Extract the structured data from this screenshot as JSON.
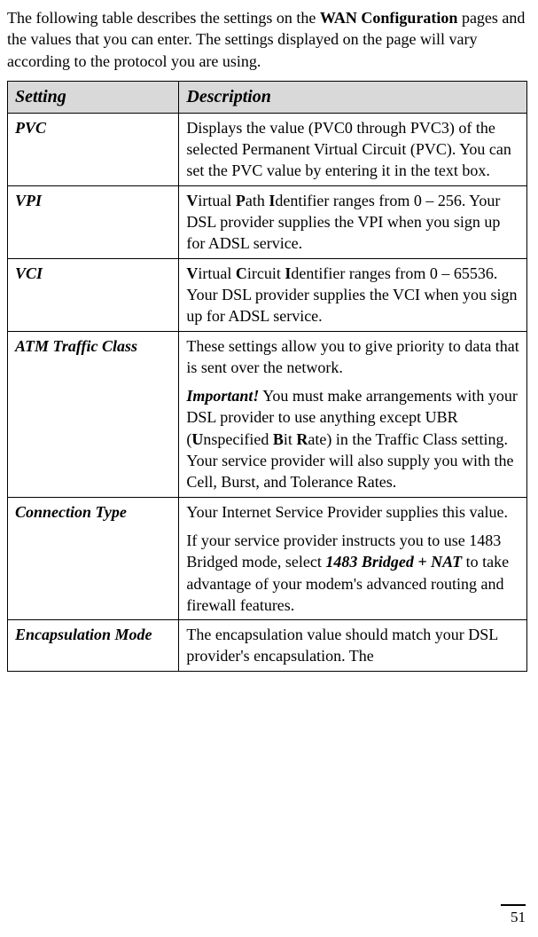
{
  "intro": {
    "prefix": "The following table describes the settings on the ",
    "bold": "WAN Configuration",
    "suffix": " pages and the values that you can enter. The settings displayed on the page will vary according to the protocol you are using."
  },
  "headers": {
    "setting": "Setting",
    "description": "Description"
  },
  "rows": {
    "pvc": {
      "name": "PVC",
      "desc": "Displays the value (PVC0 through PVC3) of the selected Permanent Virtual Circuit (PVC). You can set the PVC value by entering it in the text box."
    },
    "vpi": {
      "name": "VPI",
      "d1": "V",
      "d2": "irtual ",
      "d3": "P",
      "d4": "ath ",
      "d5": "I",
      "d6": "dentifier ranges from 0 – 256. Your DSL provider supplies the VPI when you sign up for ADSL service."
    },
    "vci": {
      "name": "VCI",
      "d1": "V",
      "d2": "irtual ",
      "d3": "C",
      "d4": "ircuit ",
      "d5": "I",
      "d6": "dentifier ranges from 0 – 65536. Your DSL provider supplies the VCI when you sign up for ADSL service."
    },
    "atm": {
      "name": "ATM Traffic Class",
      "p1": "These settings allow you to give priority to data that is sent over the network.",
      "p2a": "Important!",
      "p2b": " You must make arrangements with your DSL provider to use anything except UBR (",
      "p2c": "U",
      "p2d": "nspecified ",
      "p2e": "B",
      "p2f": "it ",
      "p2g": "R",
      "p2h": "ate) in the Traffic Class setting. Your service provider will also supply you with the Cell, Burst, and Tolerance Rates."
    },
    "conn": {
      "name": "Connection Type",
      "p1": "Your Internet Service Provider supplies this value.",
      "p2a": "If your service provider instructs you to use 1483 Bridged mode, select ",
      "p2b": "1483 Bridged + NAT",
      "p2c": " to take advantage of your modem's advanced routing and firewall features."
    },
    "encap": {
      "name": "Encapsulation Mode",
      "desc": "The encapsulation value should match your DSL provider's encapsulation. The"
    }
  },
  "pageNumber": "51"
}
